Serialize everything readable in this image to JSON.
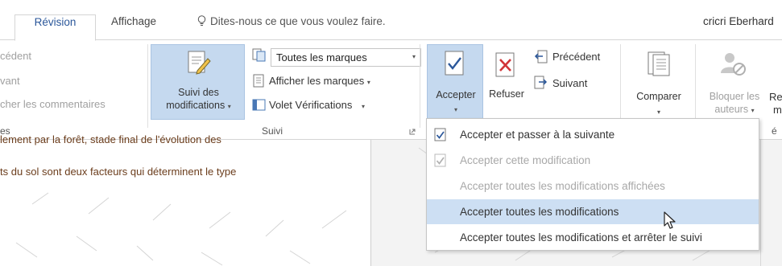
{
  "tabs": {
    "revision": "Révision",
    "affichage": "Affichage",
    "tell_me": "Dites-nous ce que vous voulez faire.",
    "user": "cricri Eberhard"
  },
  "left_group": {
    "item1": "cédent",
    "item2": "vant",
    "item3": "cher les commentaires",
    "label": "es"
  },
  "suivi": {
    "track_line1": "Suivi des",
    "track_line2": "modifications",
    "markup_select": "Toutes les marques",
    "show_markup": "Afficher les marques",
    "review_pane": "Volet Vérifications",
    "group_label": "Suivi"
  },
  "changes": {
    "accept": "Accepter",
    "reject": "Refuser",
    "previous": "Précédent",
    "next": "Suivant"
  },
  "compare": {
    "label": "Comparer"
  },
  "protect": {
    "block_line1": "Bloquer les",
    "block_line2": "auteurs",
    "cut1": "Re",
    "cut2": "m",
    "cut3": "é"
  },
  "document": {
    "line1": "lement par la forêt, stade final de l'évolution des",
    "line2": "ts du sol sont deux facteurs qui déterminent le type"
  },
  "accept_menu": {
    "items": [
      {
        "label": "Accepter et passer à la suivante",
        "icon": "accept-next-icon",
        "enabled": true
      },
      {
        "label": "Accepter cette modification",
        "icon": "accept-this-icon",
        "enabled": false
      },
      {
        "label": "Accepter toutes les modifications affichées",
        "enabled": false
      },
      {
        "label": "Accepter toutes les modifications",
        "enabled": true,
        "highlighted": true
      },
      {
        "label": "Accepter toutes les modifications et arrêter le suivi",
        "enabled": true
      }
    ]
  },
  "colors": {
    "accent": "#2b579a",
    "selected": "#c5d9ef",
    "menu_hover": "#cddff3",
    "doc_text": "#6b3d1c"
  }
}
